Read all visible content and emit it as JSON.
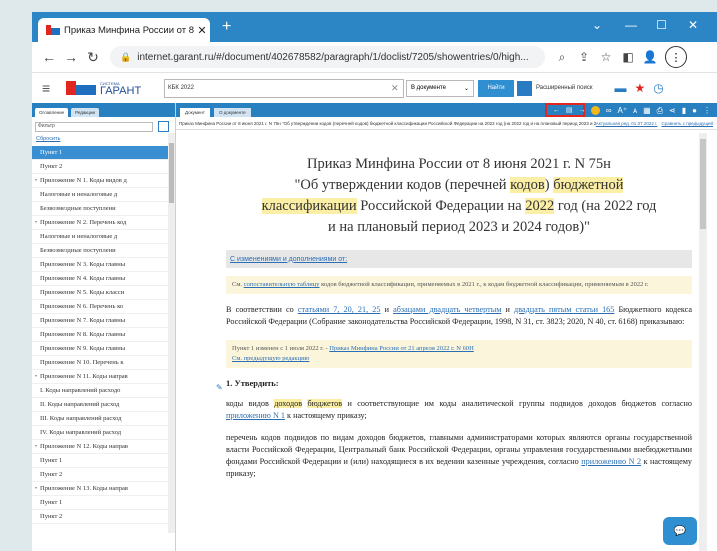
{
  "browser": {
    "tab_title": "Приказ Минфина России от 8 ию",
    "new_tab": "+",
    "url": "internet.garant.ru/#/document/402678582/paragraph/1/doclist/7205/showentries/0/high...",
    "min": "⌄",
    "restore": "—",
    "maximize": "☐",
    "close": "✕"
  },
  "header": {
    "brand_small": "СИСТЕМА",
    "brand": "ГАРАНТ",
    "search_query": "КБК 2022",
    "scope": "В документе",
    "find_label": "Найти",
    "advanced_label": "Расширенный поиск"
  },
  "sidebar": {
    "tabs": [
      "Оглавление",
      "Редакции"
    ],
    "filter_placeholder": "Фильтр",
    "reset": "Сбросить",
    "items": [
      {
        "marker": "",
        "label": "Пункт 1",
        "selected": true
      },
      {
        "marker": "",
        "label": "Пункт 2"
      },
      {
        "marker": "•",
        "label": "Приложение N 1. Коды видов д"
      },
      {
        "marker": "",
        "label": "Налоговые и неналоговые д"
      },
      {
        "marker": "",
        "label": "Безвозмездные поступлени"
      },
      {
        "marker": "•",
        "label": "Приложение N 2. Перечень код"
      },
      {
        "marker": "",
        "label": "Налоговые и неналоговые д"
      },
      {
        "marker": "",
        "label": "Безвозмездные поступлени"
      },
      {
        "marker": "",
        "label": "Приложение N 3. Коды главны"
      },
      {
        "marker": "",
        "label": "Приложение N 4. Коды главны"
      },
      {
        "marker": "",
        "label": "Приложение N 5. Коды класси"
      },
      {
        "marker": "",
        "label": "Приложение N 6. Перечень ко"
      },
      {
        "marker": "",
        "label": "Приложение N 7. Коды главны"
      },
      {
        "marker": "",
        "label": "Приложение N 8. Коды главны"
      },
      {
        "marker": "",
        "label": "Приложение N 9. Коды главны"
      },
      {
        "marker": "",
        "label": "Приложение N 10. Перечень к"
      },
      {
        "marker": "•",
        "label": "Приложение N 11. Коды направ"
      },
      {
        "marker": "",
        "label": "I. Коды направлений расходо"
      },
      {
        "marker": "",
        "label": "II. Коды направлений расход"
      },
      {
        "marker": "",
        "label": "III. Коды направлений расход"
      },
      {
        "marker": "",
        "label": "IV. Коды направлений расход"
      },
      {
        "marker": "•",
        "label": "Приложение N 12. Коды направ"
      },
      {
        "marker": "",
        "label": "Пункт 1"
      },
      {
        "marker": "",
        "label": "Пункт 2"
      },
      {
        "marker": "•",
        "label": "Приложение N 13. Коды направ"
      },
      {
        "marker": "",
        "label": "Пункт 1"
      },
      {
        "marker": "",
        "label": "Пункт 2"
      }
    ]
  },
  "doc": {
    "tabs": [
      "Документ",
      "О документе"
    ],
    "path": "Приказ Минфина России от 8 июня 2021 г. N 75н \"Об утверждении кодов (перечней кодов) бюджетной классификации Российской Федерации на 2022 год (на 2022 год и на плановый период 2023 и 2024 годов)\" Приказ Минфина России...",
    "edition": "Актуальная ред. 01.07.2022 г.",
    "compare_link": "Сравнить с предыдущей",
    "title": {
      "l1": "Приказ Минфина России от 8 июня 2021 г. N 75н",
      "l2a": "\"Об утверждении кодов (перечней ",
      "l2b": "кодов",
      "l2c": ") ",
      "l2d": "бюджетной",
      "l3a": "классификации",
      "l3b": " Российской Федерации на ",
      "l3c": "2022",
      "l3d": " год (на 2022 год",
      "l4": "и на плановый период 2023 и 2024 годов)\""
    },
    "changes": "С изменениями и дополнениями от:",
    "compare": {
      "t1": "См. ",
      "link": "сопоставительную таблицу",
      "t2": " кодов бюджетной классификации, применяемых в 2021 г., к кодам бюджетной классификации, применяемым в 2022 г."
    },
    "p1": {
      "a": "В соответствии со ",
      "l1": "статьями 7, 20, 21, 25",
      "b": " и ",
      "l2": "абзацами двадцать четвертым",
      "c": " и ",
      "l3": "двадцать пятым статьи 165",
      "d": " Бюджетного кодекса Российской Федерации (Собрание законодательства Российской Федерации, 1998, N 31, ст. 3823; 2020, N 40, ст. 6168) приказываю:"
    },
    "note": {
      "t1": "Пункт 1 изменен с 1 июля 2022 г. - ",
      "link1": "Приказ Минфина России от 21 апреля 2022 г. N 60Н",
      "link2": "См. предыдущую редакцию"
    },
    "section": "1. Утвердить:",
    "p2": {
      "a": "коды видов ",
      "h1": "доходов",
      "b": " ",
      "h2": "бюджетов",
      "c": " и соответствующие им коды аналитической группы подвидов доходов бюджетов согласно ",
      "link": "приложению N 1",
      "d": " к настоящему приказу;"
    },
    "p3": {
      "a": "перечень кодов подвидов по видам доходов бюджетов, главными администраторами которых являются органы государственной власти Российской Федерации, Центральный банк Российской Федерации, органы управления государственными внебюджетными фондами Российской Федерации и (или) находящиеся в их ведении казенные учреждения, согласно ",
      "link": "приложению N 2",
      "b": " к настоящему приказу;"
    }
  }
}
